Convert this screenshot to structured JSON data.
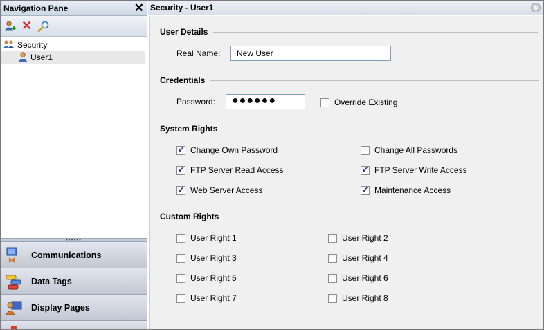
{
  "nav": {
    "title": "Navigation Pane",
    "close_glyph": "✕",
    "toolbar": [
      {
        "name": "add-user-icon"
      },
      {
        "name": "delete-icon",
        "glyph": "✕",
        "color": "#d23030"
      },
      {
        "name": "search-icon"
      }
    ],
    "tree": {
      "root_label": "Security",
      "child_label": "User1"
    },
    "splitter_glyph": "••••••",
    "buttons": [
      {
        "label": "Communications",
        "icon": "communications-icon"
      },
      {
        "label": "Data Tags",
        "icon": "data-tags-icon"
      },
      {
        "label": "Display Pages",
        "icon": "display-pages-icon"
      }
    ]
  },
  "content": {
    "title": "Security - User1",
    "pin_glyph": "↻",
    "user_details": {
      "heading": "User Details",
      "real_name_label": "Real Name:",
      "real_name_value": "New User"
    },
    "credentials": {
      "heading": "Credentials",
      "password_label": "Password:",
      "password_value": "●●●●●●",
      "override_label": "Override Existing",
      "override_checked": false
    },
    "system_rights": {
      "heading": "System Rights",
      "items": [
        {
          "label": "Change Own Password",
          "checked": true
        },
        {
          "label": "Change All Passwords",
          "checked": false
        },
        {
          "label": "FTP Server Read Access",
          "checked": true
        },
        {
          "label": "FTP Server Write Access",
          "checked": true
        },
        {
          "label": "Web Server Access",
          "checked": true
        },
        {
          "label": "Maintenance Access",
          "checked": true
        }
      ]
    },
    "custom_rights": {
      "heading": "Custom Rights",
      "items": [
        {
          "label": "User Right 1",
          "checked": false
        },
        {
          "label": "User Right 2",
          "checked": false
        },
        {
          "label": "User Right 3",
          "checked": false
        },
        {
          "label": "User Right 4",
          "checked": false
        },
        {
          "label": "User Right 5",
          "checked": false
        },
        {
          "label": "User Right 6",
          "checked": false
        },
        {
          "label": "User Right 7",
          "checked": false
        },
        {
          "label": "User Right 8",
          "checked": false
        }
      ]
    }
  }
}
